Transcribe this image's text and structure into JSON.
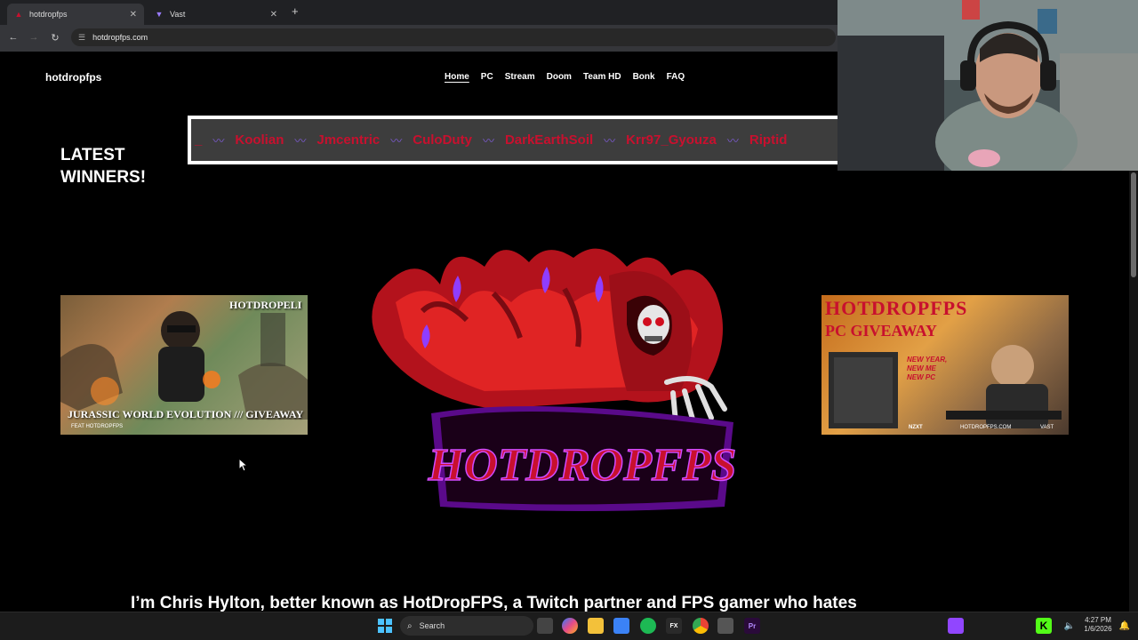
{
  "browser": {
    "tabs": [
      {
        "title": "hotdropfps",
        "active": true
      },
      {
        "title": "Vast",
        "active": false
      }
    ],
    "url": "hotdropfps.com"
  },
  "site": {
    "brand": "hotdropfps",
    "nav": [
      "Home",
      "PC",
      "Stream",
      "Doom",
      "Team HD",
      "Bonk",
      "FAQ"
    ],
    "active_nav": "Home",
    "latest_heading_line1": "LATEST",
    "latest_heading_line2": "WINNERS!",
    "winners": [
      "Koolian",
      "Jmcentric",
      "CuloDuty",
      "DarkEarthSoil",
      "Krr97_Gyouza",
      "Riptid"
    ],
    "ticker_separator": "〰",
    "left_banner": {
      "top_text": "HOTDROPELI",
      "bottom_text": "JURASSIC WORLD EVOLUTION /// GIVEAWAY",
      "footer_text": "FEAT HOTDROPFPS"
    },
    "right_banner": {
      "line1": "HOTDROPFPS",
      "line2": "PC GIVEAWAY",
      "tagline_1": "NEW YEAR,",
      "tagline_2": "NEW ME",
      "tagline_3": "NEW PC",
      "footer_left": "NZXT",
      "footer_mid": "HOTDROPFPS.COM",
      "footer_right": "VAST"
    },
    "logo_text": "HOTDROPFPS",
    "intro_text": "I’m Chris Hylton, better known as HotDropFPS, a Twitch partner and FPS gamer who hates"
  },
  "taskbar": {
    "search_placeholder": "Search",
    "time": "4:27 PM",
    "date": "1/6/2026"
  },
  "colors": {
    "accent_red": "#c8102e",
    "accent_purple": "#7c5bd1",
    "twitch_purple": "#9146ff",
    "kick_green": "#53fc18"
  }
}
